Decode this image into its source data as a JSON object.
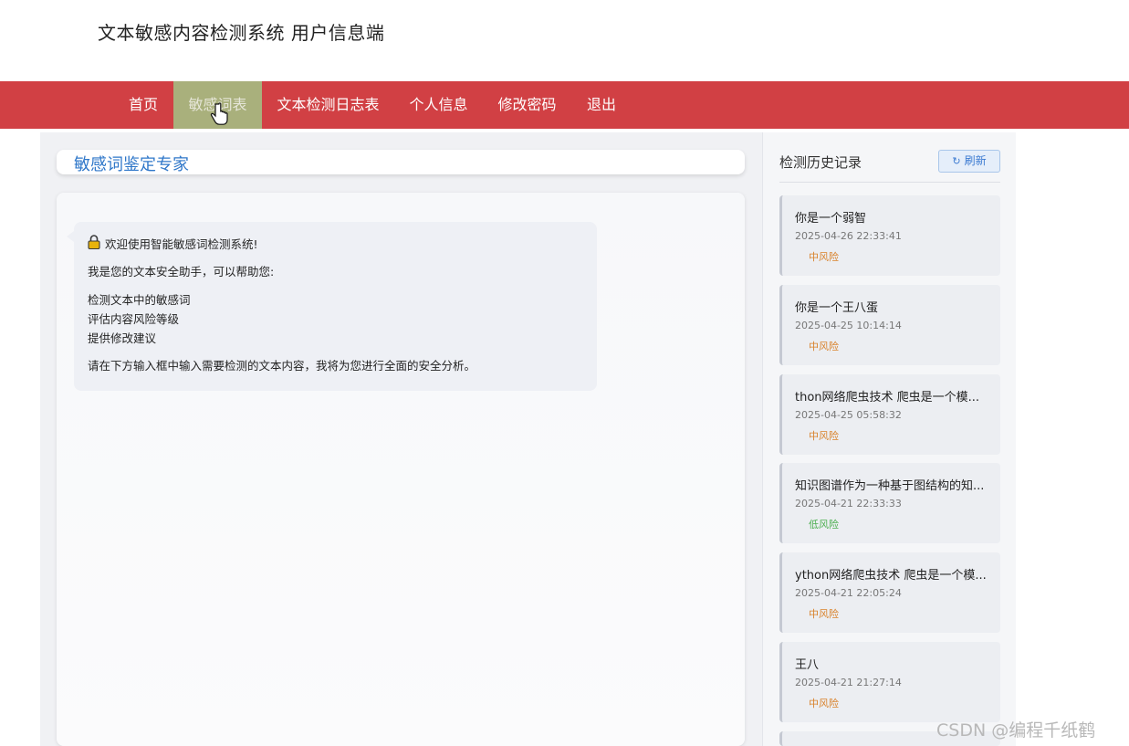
{
  "app": {
    "title": "文本敏感内容检测系统 用户信息端"
  },
  "nav": [
    {
      "label": "首页"
    },
    {
      "label": "敏感词表"
    },
    {
      "label": "文本检测日志表"
    },
    {
      "label": "个人信息"
    },
    {
      "label": "修改密码"
    },
    {
      "label": "退出"
    }
  ],
  "active_nav": "敏感词表",
  "main": {
    "title": "敏感词鉴定专家",
    "welcome": {
      "heading": "欢迎使用智能敏感词检测系统!",
      "intro": "我是您的文本安全助手，可以帮助您:",
      "features": [
        "检测文本中的敏感词",
        "评估内容风险等级",
        "提供修改建议"
      ],
      "instruction": "请在下方输入框中输入需要检测的文本内容，我将为您进行全面的安全分析。"
    }
  },
  "sidebar": {
    "title": "检测历史记录",
    "refresh_label": "刷新",
    "items": [
      {
        "text": "你是一个弱智",
        "time": "2025-04-26 22:33:41",
        "risk": "中风险"
      },
      {
        "text": "你是一个王八蛋",
        "time": "2025-04-25 10:14:14",
        "risk": "中风险"
      },
      {
        "text": "thon网络爬虫技术 爬虫是一个模...",
        "time": "2025-04-25 05:58:32",
        "risk": "中风险"
      },
      {
        "text": "知识图谱作为一种基于图结构的知...",
        "time": "2025-04-21 22:33:33",
        "risk": "低风险"
      },
      {
        "text": "ython网络爬虫技术 爬虫是一个模...",
        "time": "2025-04-21 22:05:24",
        "risk": "中风险"
      },
      {
        "text": "王八",
        "time": "2025-04-21 21:27:14",
        "risk": "中风险"
      }
    ]
  },
  "colors": {
    "medium_risk": "#d9822b",
    "low_risk": "#4caf50",
    "nav_bg": "#d14044",
    "active_nav_bg": "#a9b07c",
    "accent": "#2f77c9"
  },
  "watermark": "CSDN @编程千纸鹤"
}
